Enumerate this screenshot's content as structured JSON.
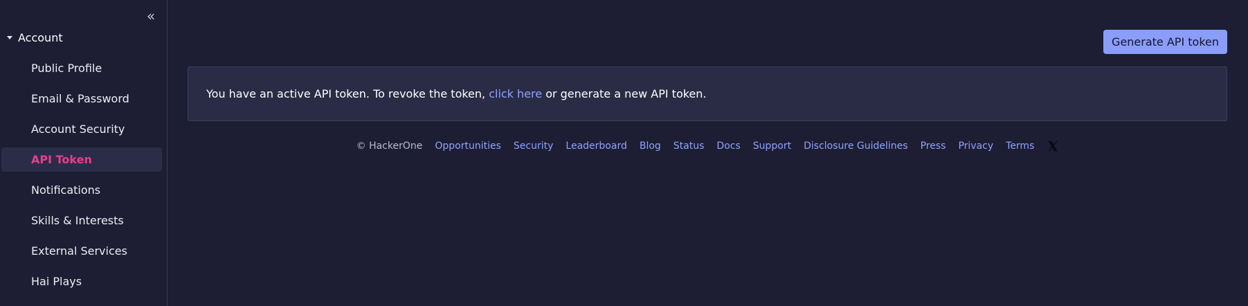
{
  "sidebar": {
    "collapse_icon": "«",
    "section_label": "Account",
    "items": [
      {
        "label": "Public Profile"
      },
      {
        "label": "Email & Password"
      },
      {
        "label": "Account Security"
      },
      {
        "label": "API Token"
      },
      {
        "label": "Notifications"
      },
      {
        "label": "Skills & Interests"
      },
      {
        "label": "External Services"
      },
      {
        "label": "Hai Plays"
      }
    ]
  },
  "main": {
    "generate_button": "Generate API token",
    "banner": {
      "text_before": "You have an active API token. To revoke the token, ",
      "link": "click here",
      "text_after": " or generate a new API token."
    }
  },
  "footer": {
    "copyright": "© HackerOne",
    "links": [
      "Opportunities",
      "Security",
      "Leaderboard",
      "Blog",
      "Status",
      "Docs",
      "Support",
      "Disclosure Guidelines",
      "Press",
      "Privacy",
      "Terms"
    ]
  },
  "colors": {
    "background": "#1d1e33",
    "active_nav": "#e83e8c",
    "link": "#8fa3ff",
    "button": "#8a9df8"
  }
}
